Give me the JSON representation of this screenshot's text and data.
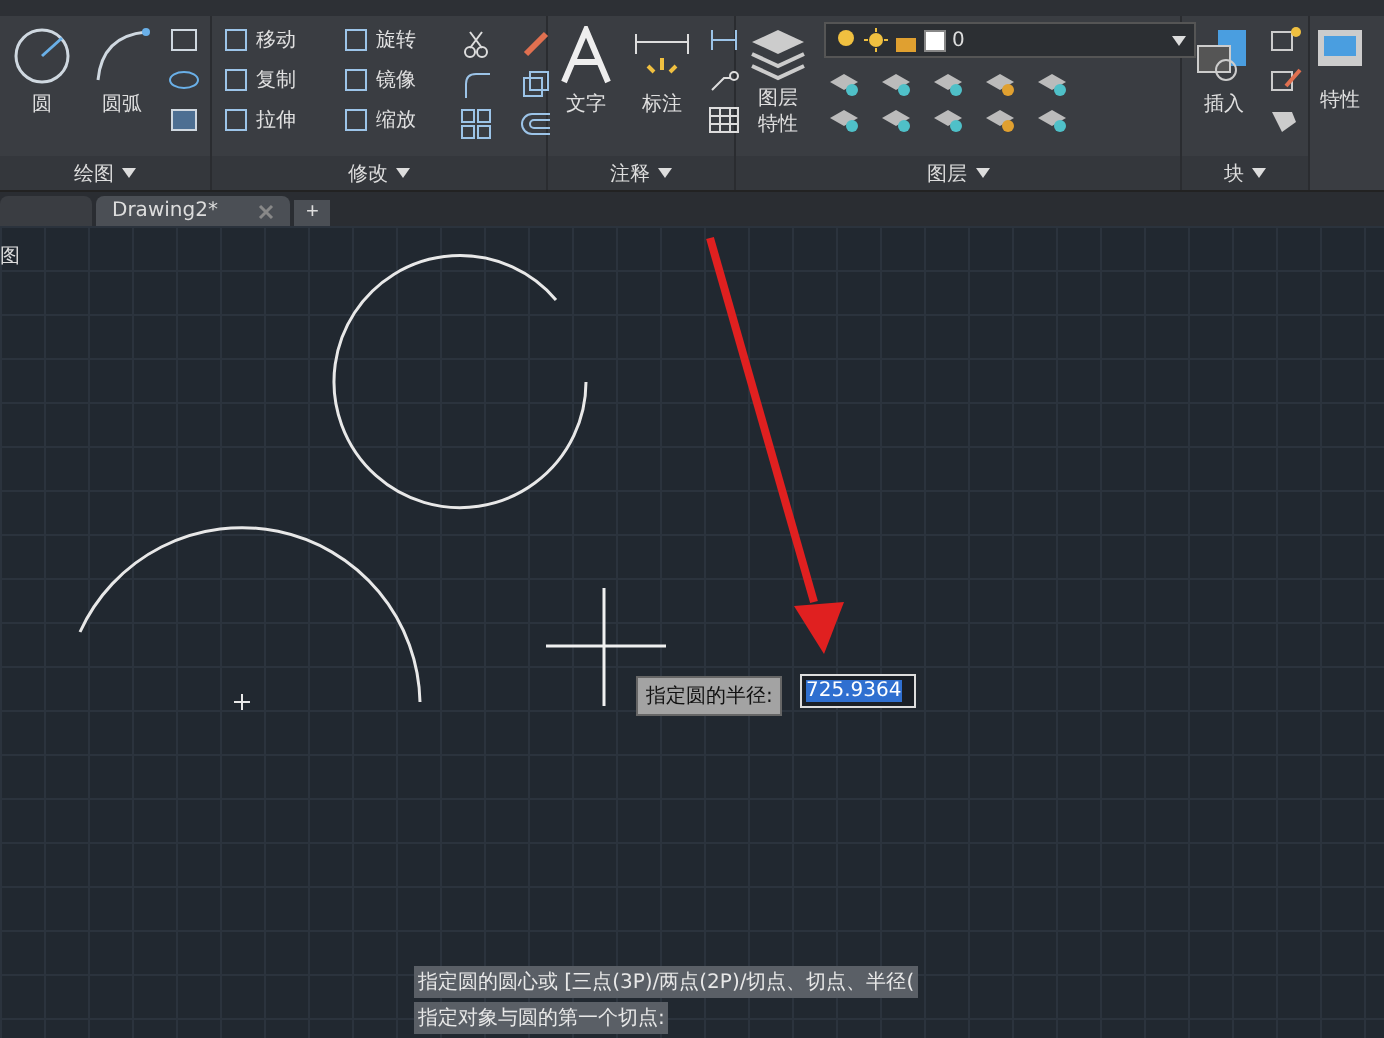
{
  "ribbon": {
    "panels": [
      {
        "kind": "draw",
        "title": "绘图",
        "large": [
          "圆",
          "圆弧"
        ]
      },
      {
        "kind": "modify",
        "title": "修改",
        "tools": [
          "移动",
          "旋转",
          "复制",
          "镜像",
          "拉伸",
          "缩放"
        ]
      },
      {
        "kind": "annotate",
        "title": "注释",
        "large": [
          "文字",
          "标注"
        ]
      },
      {
        "kind": "layers",
        "title": "图层",
        "large": [
          "图层特性"
        ],
        "layer_value": "0"
      },
      {
        "kind": "block",
        "title": "块",
        "large": [
          "插入"
        ]
      },
      {
        "kind": "properties",
        "large": [
          "特性"
        ]
      }
    ]
  },
  "tabs": [
    {
      "label": "Drawing2*",
      "selected": true
    }
  ],
  "new_tab_button": "+",
  "canvas": {
    "viewport_label": "图",
    "prompt": {
      "label": "指定圆的半径:",
      "value": "725.9364"
    },
    "command_history": [
      "指定圆的圆心或 [三点(3P)/两点(2P)/切点、切点、半径(",
      "指定对象与圆的第一个切点:"
    ]
  }
}
